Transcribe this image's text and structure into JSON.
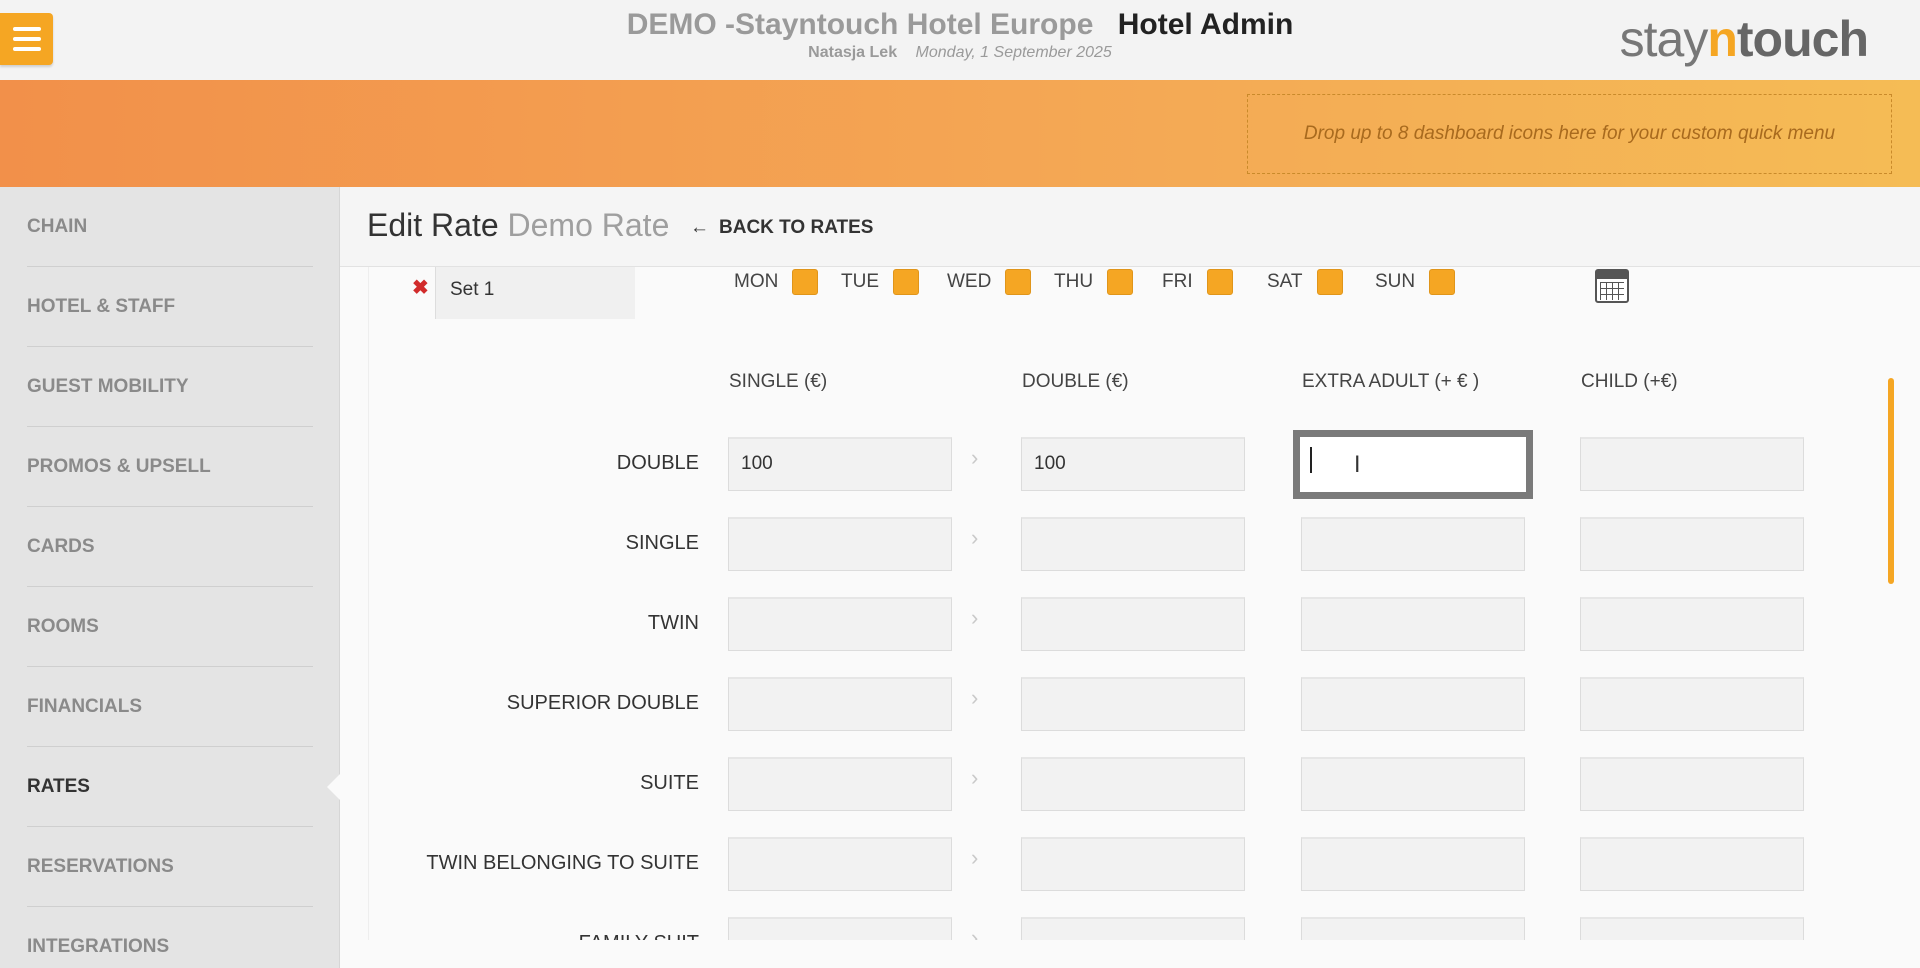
{
  "header": {
    "hotel_name": "DEMO -Stayntouch Hotel Europe",
    "app_title": "Hotel Admin",
    "user": "Natasja Lek",
    "date": "Monday, 1 September 2025",
    "logo": {
      "stay": "stay",
      "n": "n",
      "touch": "touch"
    },
    "menu_icon": "hamburger-icon"
  },
  "banner": {
    "dropzone_text": "Drop up to 8 dashboard icons here for your custom quick menu"
  },
  "sidebar": {
    "items": [
      {
        "label": "CHAIN"
      },
      {
        "label": "HOTEL & STAFF"
      },
      {
        "label": "GUEST MOBILITY"
      },
      {
        "label": "PROMOS & UPSELL"
      },
      {
        "label": "CARDS"
      },
      {
        "label": "ROOMS"
      },
      {
        "label": "FINANCIALS"
      },
      {
        "label": "RATES",
        "active": true
      },
      {
        "label": "RESERVATIONS"
      },
      {
        "label": "INTEGRATIONS"
      }
    ]
  },
  "page": {
    "title": "Edit Rate",
    "rate_name": "Demo Rate",
    "back_arrow": "←",
    "back_label": "BACK TO RATES"
  },
  "set": {
    "remove_icon": "✖",
    "name": "Set 1",
    "days": [
      "MON",
      "TUE",
      "WED",
      "THU",
      "FRI",
      "SAT",
      "SUN"
    ],
    "calendar_icon": "calendar-icon"
  },
  "table": {
    "columns": [
      "SINGLE (€)",
      "DOUBLE (€)",
      "EXTRA ADULT (+ € )",
      "CHILD (+€)"
    ],
    "rows": [
      {
        "label": "DOUBLE",
        "values": [
          "100",
          "100",
          "",
          ""
        ]
      },
      {
        "label": "SINGLE",
        "values": [
          "",
          "",
          "",
          ""
        ]
      },
      {
        "label": "TWIN",
        "values": [
          "",
          "",
          "",
          ""
        ]
      },
      {
        "label": "SUPERIOR DOUBLE",
        "values": [
          "",
          "",
          "",
          ""
        ]
      },
      {
        "label": "SUITE",
        "values": [
          "",
          "",
          "",
          ""
        ]
      },
      {
        "label": "TWIN BELONGING TO SUITE",
        "values": [
          "",
          "",
          "",
          ""
        ]
      },
      {
        "label": "FAMILY SUIT",
        "values": [
          "",
          "",
          "",
          ""
        ]
      }
    ],
    "copy_arrow": "›",
    "focused_field": "EXTRA ADULT (+ € ) / DOUBLE"
  },
  "colors": {
    "accent": "#f5a623",
    "banner_start": "#f2904a",
    "banner_end": "#f5bc55",
    "remove": "#d12b2b"
  }
}
